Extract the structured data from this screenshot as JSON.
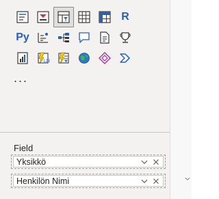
{
  "visualizations": {
    "rows": [
      [
        {
          "name": "table-visual-icon",
          "selected": false
        },
        {
          "name": "funnel-chart-icon",
          "selected": false
        },
        {
          "name": "slicer-visual-icon",
          "selected": true
        },
        {
          "name": "matrix-grid-icon",
          "selected": false
        },
        {
          "name": "matrix-visual-icon",
          "selected": false
        },
        {
          "name": "r-script-visual-icon",
          "selected": false,
          "text": "R"
        }
      ],
      [
        {
          "name": "python-visual-icon",
          "selected": false,
          "text": "Py"
        },
        {
          "name": "key-influencers-icon",
          "selected": false
        },
        {
          "name": "decomposition-tree-icon",
          "selected": false
        },
        {
          "name": "qa-visual-icon",
          "selected": false
        },
        {
          "name": "smart-narrative-icon",
          "selected": false
        },
        {
          "name": "goals-trophy-icon",
          "selected": false
        }
      ],
      [
        {
          "name": "paginated-report-icon",
          "selected": false
        },
        {
          "name": "power-apps-icon",
          "selected": false
        },
        {
          "name": "power-automate-icon",
          "selected": false
        },
        {
          "name": "arcgis-map-icon",
          "selected": false
        },
        {
          "name": "power-apps-diamond-icon",
          "selected": false
        },
        {
          "name": "power-automate-chevron-icon",
          "selected": false
        }
      ]
    ],
    "more_label": "..."
  },
  "fields": {
    "label": "Field",
    "items": [
      {
        "label": "Yksikkö"
      },
      {
        "label": "Henkilön Nimi"
      }
    ]
  }
}
